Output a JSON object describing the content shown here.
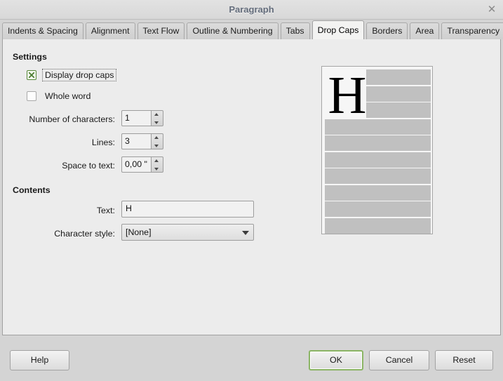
{
  "window": {
    "title": "Paragraph",
    "close_icon": "close-icon"
  },
  "tabs": [
    {
      "label": "Indents & Spacing",
      "active": false
    },
    {
      "label": "Alignment",
      "active": false
    },
    {
      "label": "Text Flow",
      "active": false
    },
    {
      "label": "Outline & Numbering",
      "active": false
    },
    {
      "label": "Tabs",
      "active": false
    },
    {
      "label": "Drop Caps",
      "active": true
    },
    {
      "label": "Borders",
      "active": false
    },
    {
      "label": "Area",
      "active": false
    },
    {
      "label": "Transparency",
      "active": false
    }
  ],
  "settings": {
    "group_label": "Settings",
    "display_drop_caps": {
      "label": "Display drop caps",
      "checked": true,
      "focused": true
    },
    "whole_word": {
      "label": "Whole word",
      "checked": false
    },
    "number_of_characters": {
      "label": "Number of characters:",
      "value": "1"
    },
    "lines": {
      "label": "Lines:",
      "value": "3"
    },
    "space_to_text": {
      "label": "Space to text:",
      "value": "0,00 \""
    }
  },
  "contents": {
    "group_label": "Contents",
    "text": {
      "label": "Text:",
      "value": "H",
      "placeholder": ""
    },
    "character_style": {
      "label": "Character style:",
      "value": "[None]"
    }
  },
  "preview": {
    "dropcap_letter": "H",
    "line_count": 10,
    "indented_lines": 3,
    "bar_color": "#c0c0c0",
    "page_color": "#f6f6f6"
  },
  "buttons": {
    "help": "Help",
    "ok": "OK",
    "cancel": "Cancel",
    "reset": "Reset"
  },
  "colors": {
    "accent_focus": "#8ab464",
    "checkbox_check": "#4e7d33",
    "dialog_bg": "#d4d4d4",
    "panel_bg": "#ececec",
    "title_text": "#636c7b"
  }
}
